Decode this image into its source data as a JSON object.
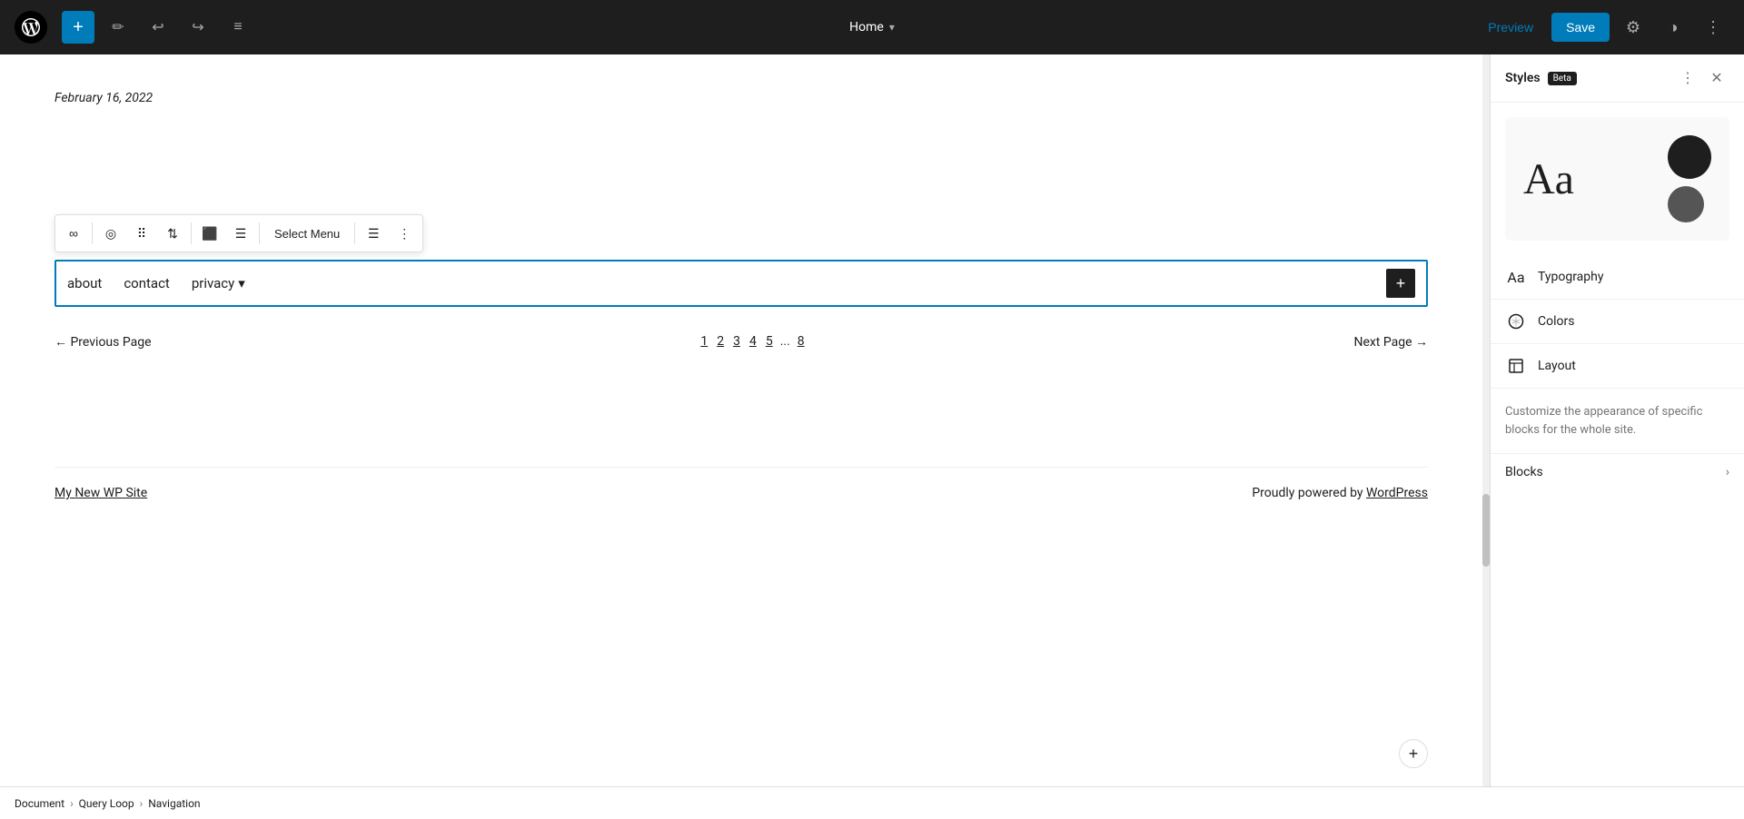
{
  "toolbar": {
    "add_label": "+",
    "undo_label": "↩",
    "redo_label": "↪",
    "list_view_label": "≡",
    "page_title": "Home",
    "preview_label": "Preview",
    "save_label": "Save"
  },
  "canvas": {
    "date": "February 16, 2022",
    "nav_links": [
      {
        "label": "about"
      },
      {
        "label": "contact"
      },
      {
        "label": "privacy",
        "has_submenu": true
      }
    ],
    "block_toolbar": {
      "select_menu_label": "Select Menu"
    },
    "pagination": {
      "prev_label": "← Previous Page",
      "next_label": "Next Page →",
      "pages": [
        "1",
        "2",
        "3",
        "4",
        "5",
        "...",
        "8"
      ]
    },
    "footer": {
      "site_link": "My New WP Site",
      "powered_text": "Proudly powered by ",
      "powered_link": "WordPress"
    }
  },
  "styles_panel": {
    "title": "Styles",
    "beta_label": "Beta",
    "preview_text": "Aa",
    "typography_label": "Typography",
    "colors_label": "Colors",
    "layout_label": "Layout",
    "description": "Customize the appearance of specific blocks for the whole site.",
    "blocks_label": "Blocks"
  },
  "breadcrumb": {
    "items": [
      {
        "label": "Document"
      },
      {
        "label": "Query Loop"
      },
      {
        "label": "Navigation"
      }
    ]
  }
}
